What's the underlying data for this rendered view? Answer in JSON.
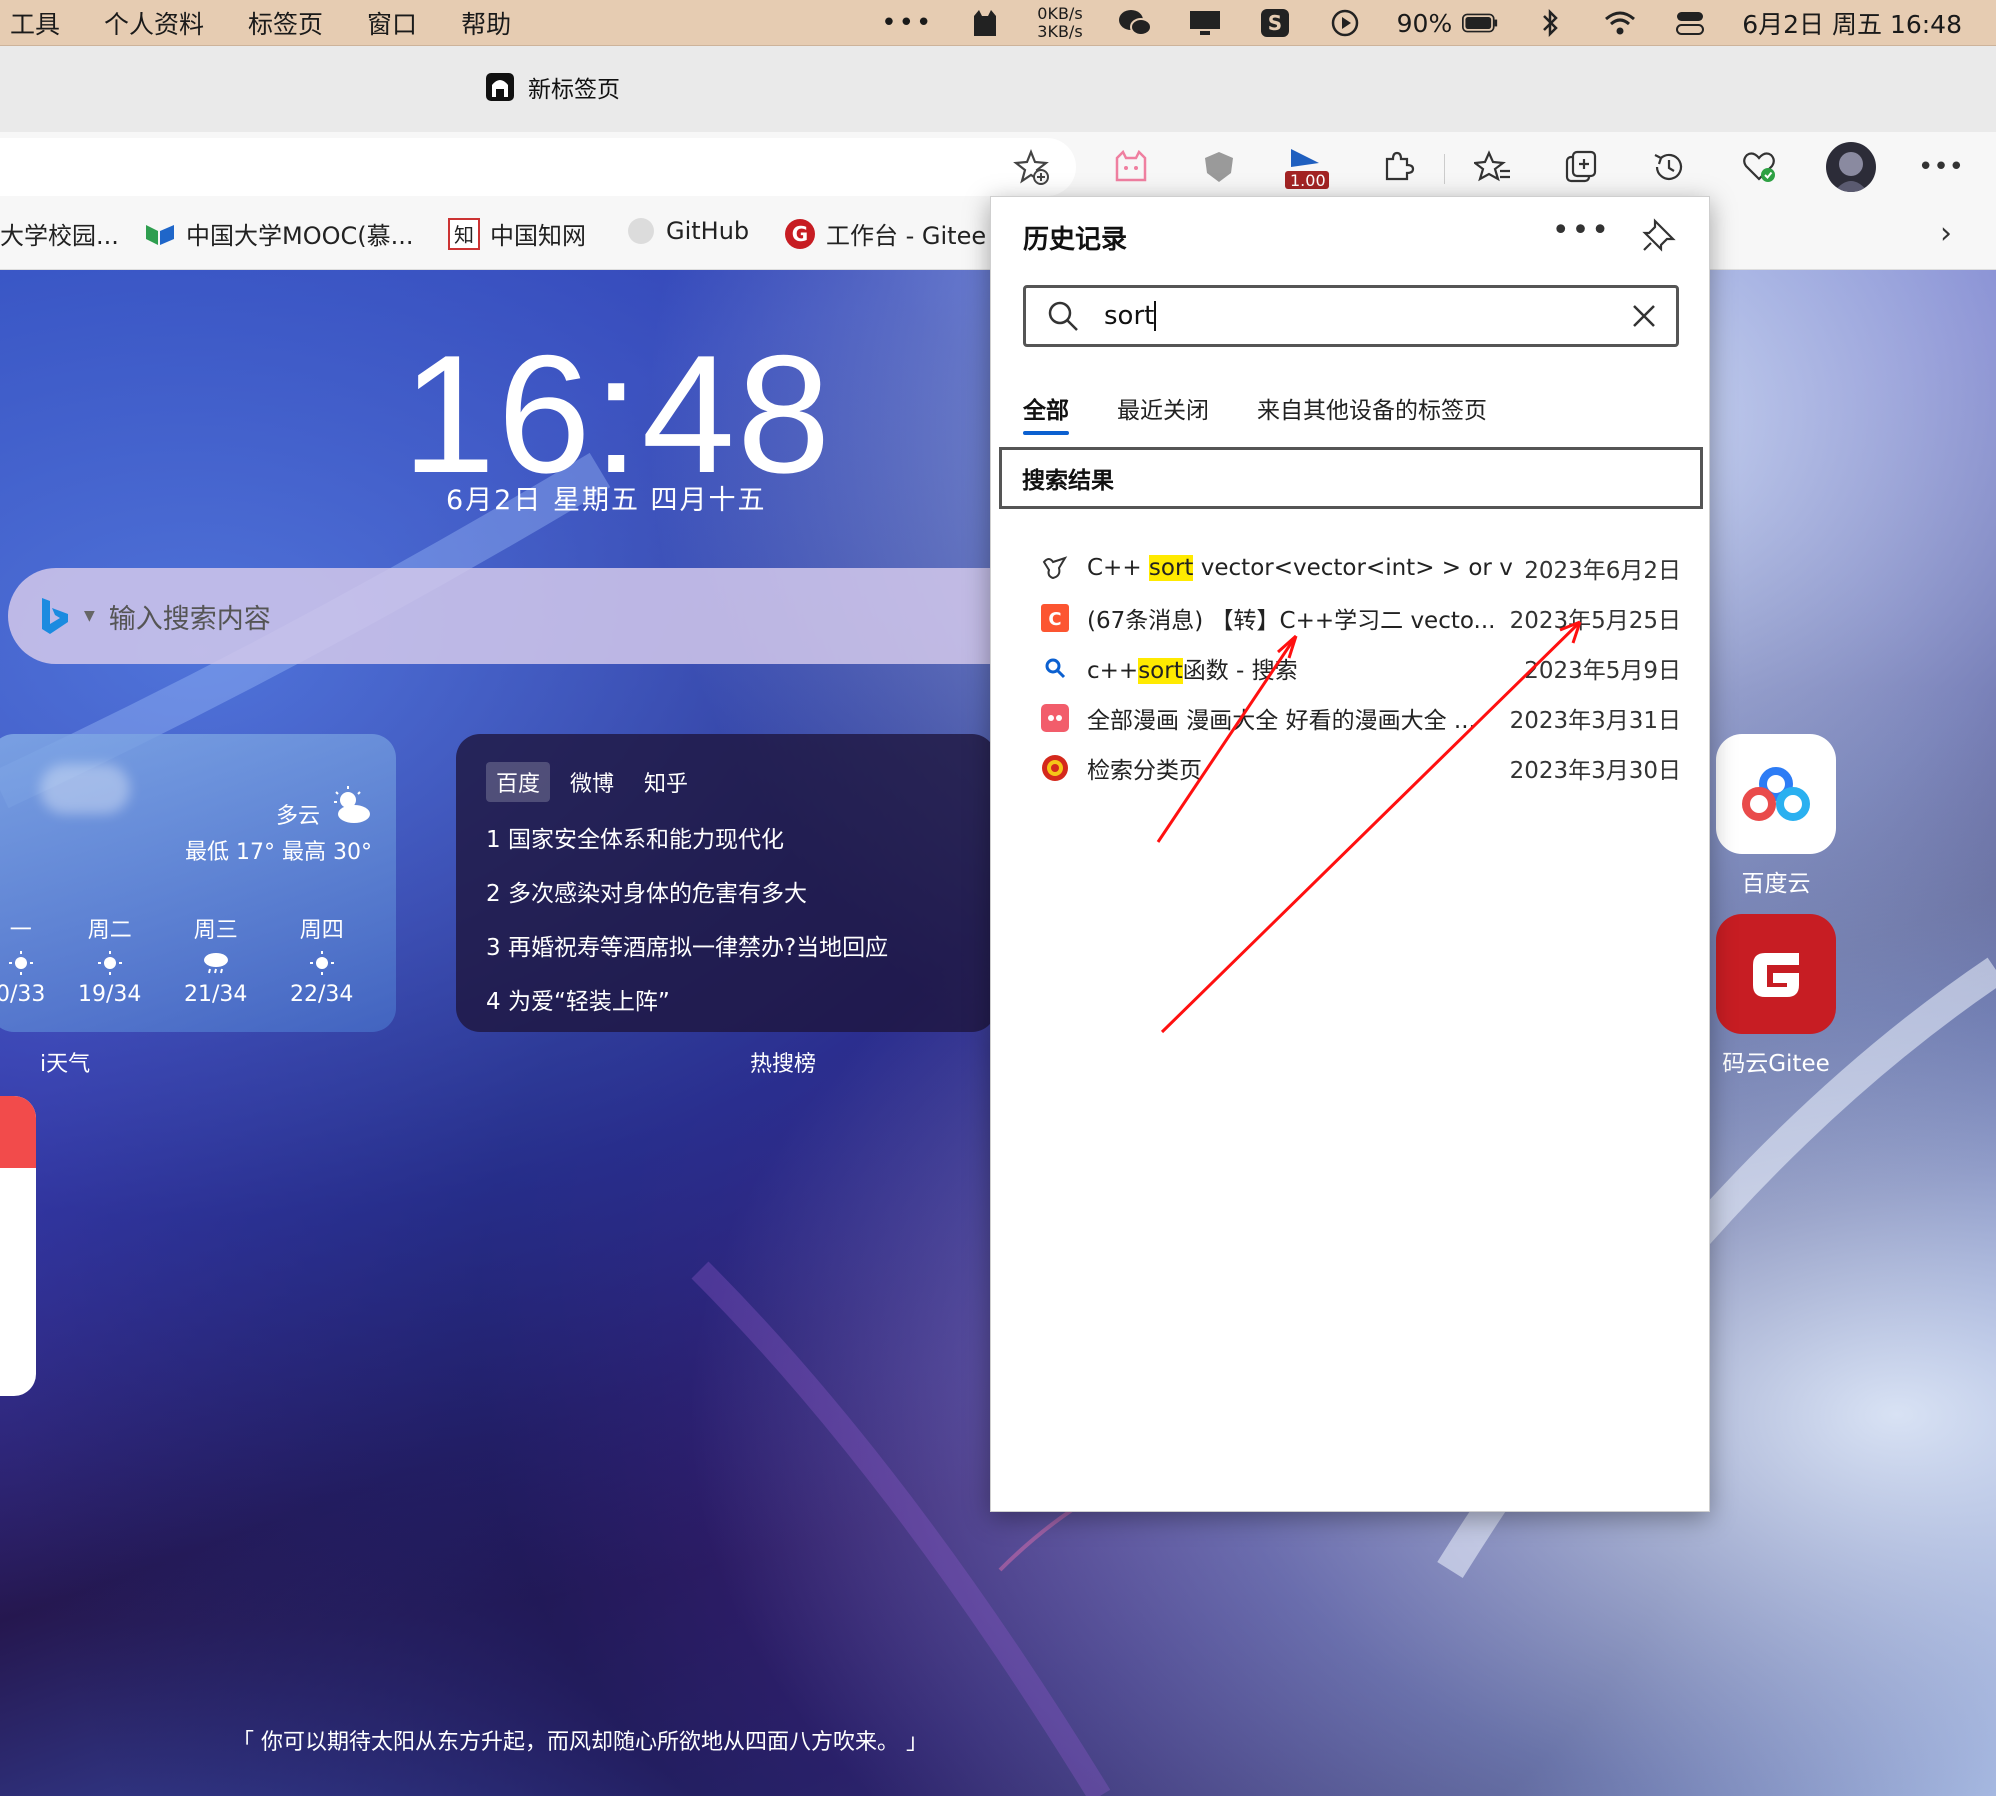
{
  "menubar": {
    "items": [
      "工具",
      "个人资料",
      "标签页",
      "窗口",
      "帮助"
    ],
    "net_up": "0KB/s",
    "net_down": "3KB/s",
    "battery": "90%",
    "datetime": "6月2日 周五  16:48"
  },
  "browser": {
    "tab_title": "新标签页",
    "speed_badge": "1.00",
    "bookmarks": [
      "大学校园...",
      "中国大学MOOC(慕...",
      "中国知网",
      "GitHub",
      "工作台 - Gitee"
    ]
  },
  "newtab": {
    "clock": "16:48",
    "date": "6月2日   星期五   四月十五",
    "search_placeholder": "输入搜索内容",
    "weather": {
      "desc": "多云",
      "range": "最低 17°  最高 30°",
      "forecast": [
        {
          "day": "一",
          "temp": "0/33"
        },
        {
          "day": "周二",
          "temp": "19/34"
        },
        {
          "day": "周三",
          "temp": "21/34"
        },
        {
          "day": "周四",
          "temp": "22/34"
        }
      ],
      "label": "i天气"
    },
    "hot": {
      "tabs": [
        "百度",
        "微博",
        "知乎"
      ],
      "items": [
        "1   国家安全体系和能力现代化",
        "2   多次感染对身体的危害有多大",
        "3   再婚祝寿等酒席拟一律禁办?当地回应",
        "4   为爱“轻装上阵”"
      ],
      "label": "热搜榜"
    },
    "apps": [
      {
        "label": "百度云"
      },
      {
        "label": "码云Gitee"
      }
    ],
    "quote": "「 你可以期待太阳从东方升起，而风却随心所欲地从四面八方吹来。 」"
  },
  "history": {
    "title": "历史记录",
    "search_value": "sort",
    "tabs": [
      "全部",
      "最近关闭",
      "来自其他设备的标签页"
    ],
    "section": "搜索结果",
    "results": [
      {
        "pre": "C++ ",
        "hl": "sort",
        "post": " vector<vector<int> > or v...",
        "date": "2023年6月2日",
        "icon": "bird-icon",
        "color": "#333333"
      },
      {
        "pre": "(67条消息) 【转】C++学习二 vecto...",
        "hl": "",
        "post": "",
        "date": "2023年5月25日",
        "icon": "csdn-icon",
        "color": "#fc5531"
      },
      {
        "pre": "c++",
        "hl": "sort",
        "post": "函数 - 搜索",
        "date": "2023年5月9日",
        "icon": "search-icon",
        "color": "#0b60d0"
      },
      {
        "pre": "全部漫画 漫画大全 好看的漫画大全 ...",
        "hl": "",
        "post": "",
        "date": "2023年3月31日",
        "icon": "manga-icon",
        "color": "#f25d6b"
      },
      {
        "pre": "检索分类页",
        "hl": "",
        "post": "",
        "date": "2023年3月30日",
        "icon": "emblem-icon",
        "color": "#d4281c"
      }
    ]
  },
  "colors": {
    "menubar": "#e6ccb2",
    "highlight": "#ffea00",
    "accent": "#0b60d0",
    "annotation": "#ff0000"
  }
}
